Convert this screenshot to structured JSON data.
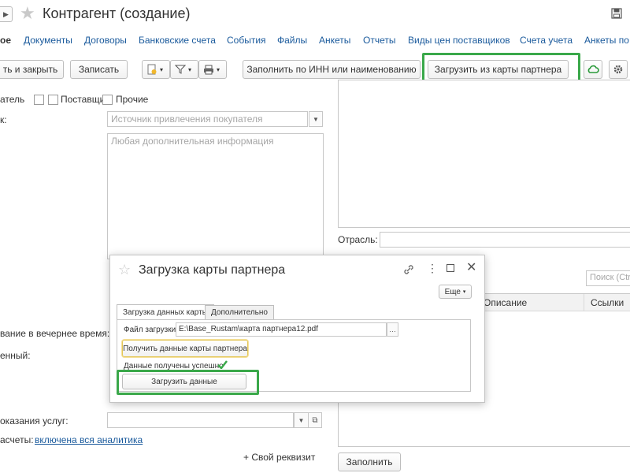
{
  "window": {
    "title": "Контрагент (создание)"
  },
  "nav": {
    "items": [
      {
        "label": "ое",
        "active": true
      },
      {
        "label": "Документы"
      },
      {
        "label": "Договоры"
      },
      {
        "label": "Банковские счета"
      },
      {
        "label": "События"
      },
      {
        "label": "Файлы"
      },
      {
        "label": "Анкеты"
      },
      {
        "label": "Отчеты"
      },
      {
        "label": "Виды цен поставщиков"
      },
      {
        "label": "Счета учета"
      },
      {
        "label": "Анкеты по"
      }
    ]
  },
  "toolbar": {
    "save_close_label": "ть и закрыть",
    "write_label": "Записать",
    "fill_inn_label": "Заполнить по ИНН или наименованию",
    "load_card_label": "Загрузить из карты партнера"
  },
  "form": {
    "checkbox_buyer_label": "атель",
    "checkbox_supplier_label": "Поставщик",
    "checkbox_other_label": "Прочие",
    "source_label": "к:",
    "source_placeholder": "Источник привлечения покупателя",
    "notes_placeholder": "Любая дополнительная информация",
    "evening_label": "вание в вечернее время:",
    "responsible_label": "енный:",
    "service_label": "оказания услуг:",
    "settlements_label": "асчеты:",
    "settlements_link": "включена вся аналитика",
    "add_field_label": "+ Свой реквизит"
  },
  "right_panel": {
    "industry_label": "Отрасль:",
    "search_placeholder": "Поиск (Ctrl",
    "col_description": "Описание",
    "col_links": "Ссылки",
    "fill_button": "Заполнить"
  },
  "dialog": {
    "title": "Загрузка карты партнера",
    "more_label": "Еще",
    "tab_load": "Загрузка данных карты",
    "tab_extra": "Дополнительно",
    "file_label": "Файл загрузки:",
    "file_value": "E:\\Base_Rustam\\карта партнера12.pdf",
    "get_data_button": "Получить данные карты партнера",
    "success_text": "Данные получены успешно",
    "load_data_button": "Загрузить данные"
  },
  "colors": {
    "accent_green": "#3aa84a",
    "link_blue": "#1a5a9c"
  }
}
